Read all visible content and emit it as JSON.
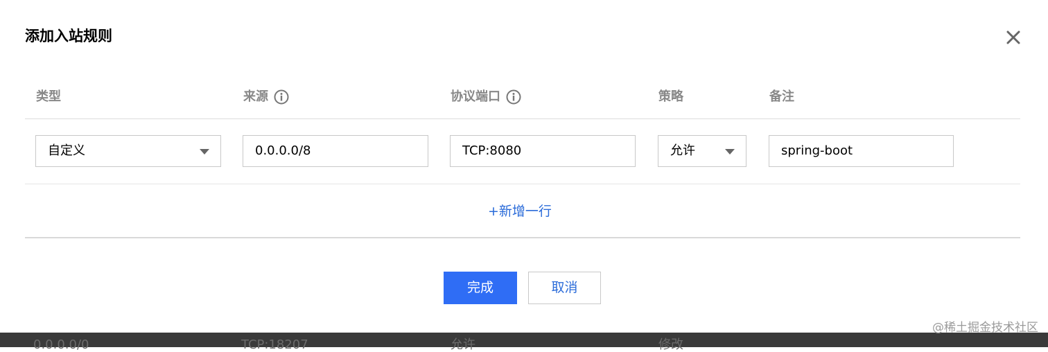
{
  "dialog": {
    "title": "添加入站规则",
    "close_icon": "close-icon"
  },
  "columns": [
    {
      "label": "类型",
      "has_info": false
    },
    {
      "label": "来源",
      "has_info": true,
      "icon": "info-circle-icon"
    },
    {
      "label": "协议端口",
      "has_info": true,
      "icon": "info-circle-icon"
    },
    {
      "label": "策略",
      "has_info": false
    },
    {
      "label": "备注",
      "has_info": false
    }
  ],
  "rule_row": {
    "type_value": "自定义",
    "source_value": "0.0.0.0/8",
    "port_value": "TCP:8080",
    "policy_value": "允许",
    "remark_value": "spring-boot"
  },
  "add_row_label": "+新增一行",
  "buttons": {
    "confirm_label": "完成",
    "cancel_label": "取消"
  },
  "background_row": {
    "source": "0.0.0.0/0",
    "port": "TCP:18207",
    "policy": "允许",
    "action": "修改"
  },
  "watermark": "@稀土掘金技术社区",
  "colors": {
    "primary": "#2f6df5",
    "link": "#2a6bd9",
    "border": "#c8c8c8",
    "header_text": "#888888"
  }
}
